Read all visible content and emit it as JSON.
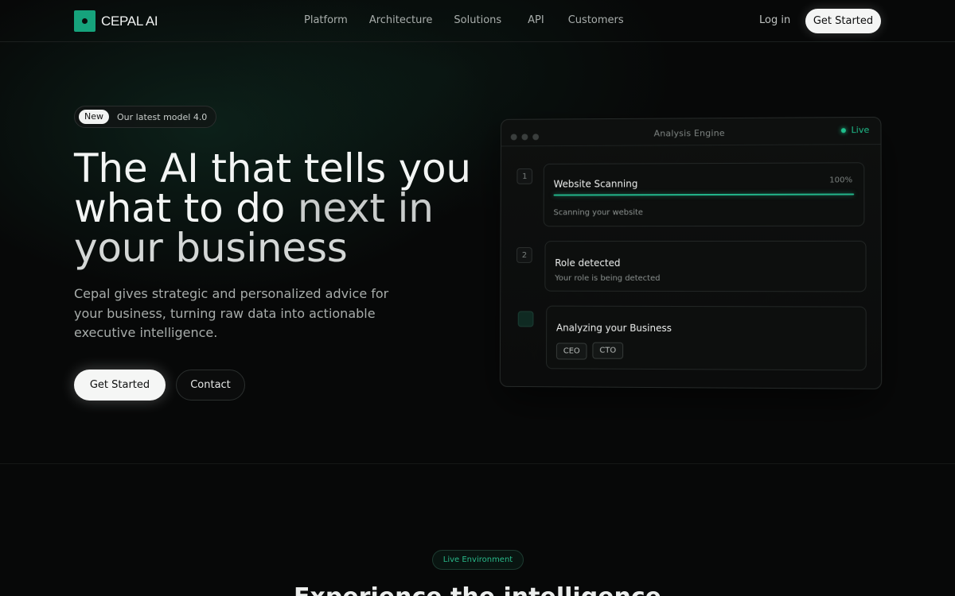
{
  "nav": {
    "logo_text": "CEPAL AI",
    "links": [
      "Platform",
      "Architecture",
      "Solutions",
      "API",
      "Customers"
    ],
    "login": "Log in",
    "cta": "Get Started"
  },
  "hero": {
    "badge_pill": "New",
    "badge_text": "Our latest model 4.0",
    "title_line1": "The AI that tells you",
    "title_line2_a": "what to do ",
    "title_line2_b": "next in",
    "title_line3": "your business",
    "subtitle": "Cepal gives strategic and personalized advice for your business, turning raw data into actionable executive intelligence.",
    "primary_button": "Get Started",
    "secondary_button": "Contact"
  },
  "engine": {
    "title": "Analysis Engine",
    "status": "Live",
    "steps": [
      {
        "number": "1",
        "title": "Website Scanning",
        "subtitle": "Scanning your website",
        "progress_label": "100%",
        "progress": 1.0
      },
      {
        "number": "2",
        "title": "Role detected",
        "subtitle": "Your role is being detected"
      },
      {
        "number": "",
        "title": "Analyzing your Business",
        "tags": [
          "CEO",
          "CTO"
        ]
      }
    ]
  },
  "lower": {
    "badge": "Live Environment",
    "title": "Experience the intelligence"
  },
  "colors": {
    "accent": "#16a37c",
    "live": "#1fbf8c",
    "background": "#070808"
  }
}
